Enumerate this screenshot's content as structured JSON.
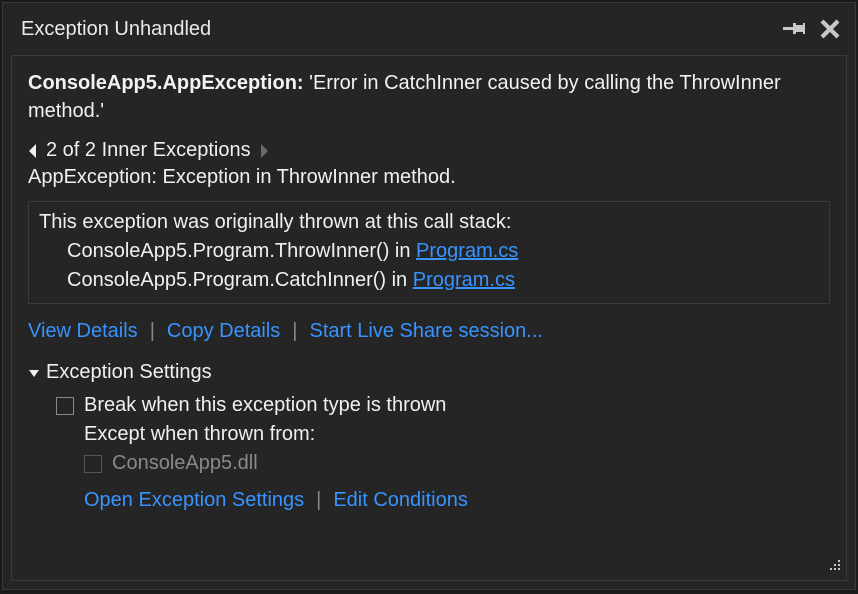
{
  "title": "Exception Unhandled",
  "exception_type": "ConsoleApp5.AppException:",
  "exception_message": "'Error in CatchInner caused by calling the ThrowInner method.'",
  "inner_nav": {
    "count_text": "2 of 2 Inner Exceptions"
  },
  "inner_exception_text": "AppException: Exception in ThrowInner method.",
  "stack": {
    "intro": "This exception was originally thrown at this call stack:",
    "frames": [
      {
        "method": "ConsoleApp5.Program.ThrowInner() in ",
        "file": "Program.cs"
      },
      {
        "method": "ConsoleApp5.Program.CatchInner() in ",
        "file": "Program.cs"
      }
    ]
  },
  "actions": {
    "view_details": "View Details",
    "copy_details": "Copy Details",
    "live_share": "Start Live Share session..."
  },
  "settings": {
    "header": "Exception Settings",
    "break_label": "Break when this exception type is thrown",
    "except_label": "Except when thrown from:",
    "module": "ConsoleApp5.dll"
  },
  "actions2": {
    "open_settings": "Open Exception Settings",
    "edit_conditions": "Edit Conditions"
  }
}
